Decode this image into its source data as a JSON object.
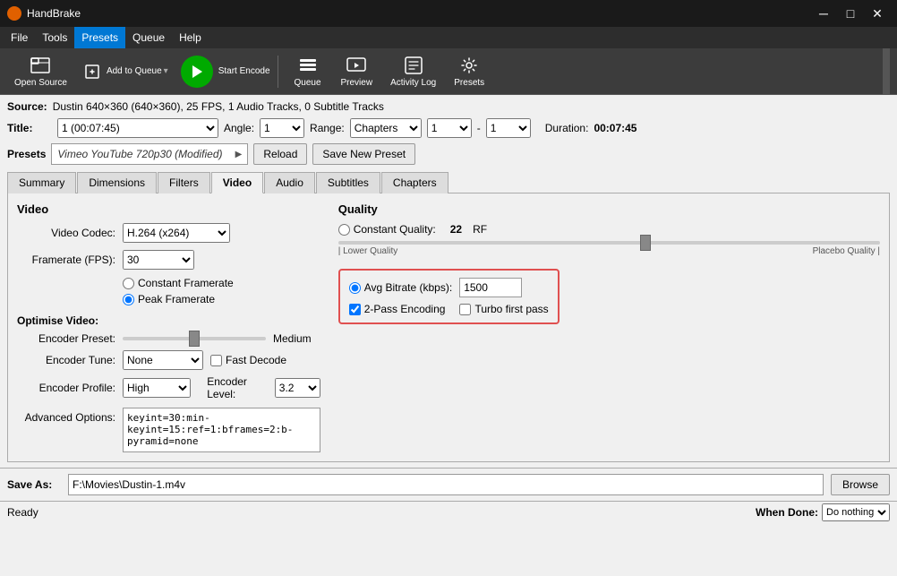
{
  "titleBar": {
    "appName": "HandBrake",
    "minBtn": "─",
    "maxBtn": "□",
    "closeBtn": "✕"
  },
  "menuBar": {
    "items": [
      "File",
      "Tools",
      "Presets",
      "Queue",
      "Help"
    ]
  },
  "toolbar": {
    "openSource": "Open Source",
    "addToQueue": "Add to Queue",
    "startEncode": "Start Encode",
    "queue": "Queue",
    "preview": "Preview",
    "activityLog": "Activity Log",
    "presets": "Presets"
  },
  "source": {
    "label": "Source:",
    "value": "Dustin  640×360 (640×360), 25 FPS, 1 Audio Tracks, 0 Subtitle Tracks"
  },
  "title": {
    "label": "Title:",
    "value": "1 (00:07:45)",
    "angleLabel": "Angle:",
    "angleValue": "1",
    "rangeLabel": "Range:",
    "rangeValue": "Chapters",
    "startValue": "1",
    "endValue": "1",
    "durationLabel": "Duration:",
    "durationValue": "00:07:45"
  },
  "presets": {
    "label": "Presets",
    "currentPreset": "Vimeo YouTube 720p30 (Modified)",
    "reloadBtn": "Reload",
    "saveNewPresetBtn": "Save New Preset"
  },
  "tabs": {
    "items": [
      "Summary",
      "Dimensions",
      "Filters",
      "Video",
      "Audio",
      "Subtitles",
      "Chapters"
    ],
    "active": "Video"
  },
  "videoTab": {
    "videoSection": {
      "title": "Video",
      "codecLabel": "Video Codec:",
      "codecValue": "H.264 (x264)",
      "framerateLabel": "Framerate (FPS):",
      "framerateValue": "30",
      "constantFramerate": "Constant Framerate",
      "peakFramerate": "Peak Framerate"
    },
    "qualitySection": {
      "title": "Quality",
      "constantQualityLabel": "Constant Quality:",
      "rfValue": "22",
      "rfUnit": "RF",
      "lowerQualityLabel": "| Lower Quality",
      "placeboQualityLabel": "Placebo Quality |",
      "avgBitrateLabel": "Avg Bitrate (kbps):",
      "avgBitrateValue": "1500",
      "twoPassLabel": "2-Pass Encoding",
      "turboFirstPassLabel": "Turbo first pass"
    },
    "optimiseSection": {
      "title": "Optimise Video:",
      "encoderPresetLabel": "Encoder Preset:",
      "encoderPresetValue": "Medium",
      "encoderTuneLabel": "Encoder Tune:",
      "encoderTuneValue": "None",
      "fastDecodeLabel": "Fast Decode",
      "encoderProfileLabel": "Encoder Profile:",
      "encoderProfileValue": "High",
      "encoderLevelLabel": "Encoder Level:",
      "encoderLevelValue": "3.2",
      "advancedOptionsLabel": "Advanced Options:",
      "advancedOptionsValue": "keyint=30:min-keyint=15:ref=1:bframes=2:b-pyramid=none"
    }
  },
  "saveAs": {
    "label": "Save As:",
    "value": "F:\\Movies\\Dustin-1.m4v",
    "browseBtn": "Browse"
  },
  "statusBar": {
    "status": "Ready",
    "whenDoneLabel": "When Done:",
    "whenDoneValue": "Do nothing"
  }
}
